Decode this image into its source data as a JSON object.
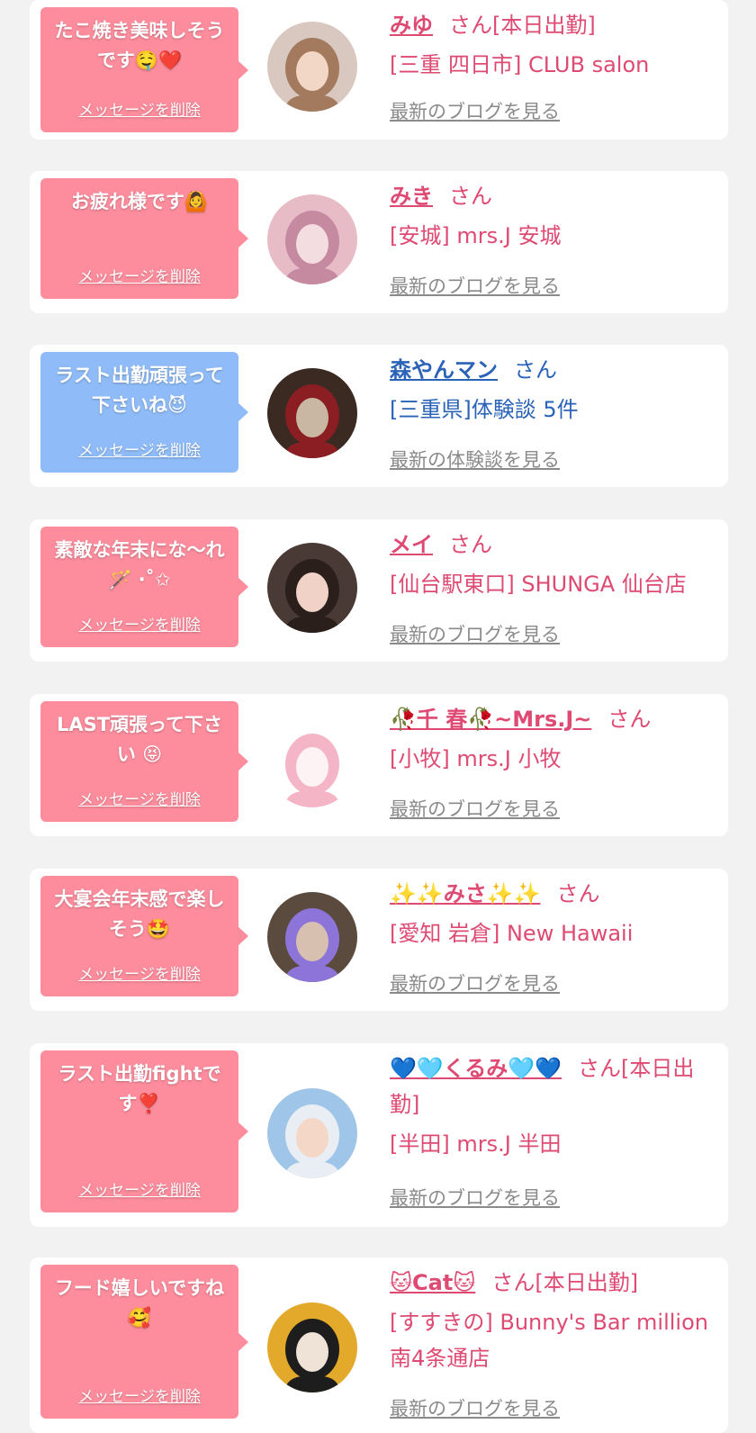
{
  "items": [
    {
      "message": "たこ焼き美味しそうです🤤❤️",
      "delete_label": "メッセージを削除",
      "name": "みゆ",
      "suffix": "さん[本日出勤]",
      "shop": "[三重 四日市] CLUB salon",
      "more": "最新のブログを見る",
      "theme": "pink",
      "avatar": {
        "bg": "#d9c8c0",
        "fg": "#a37a5e",
        "skin": "#f2d6c6"
      }
    },
    {
      "message": "お疲れ様です🙆",
      "delete_label": "メッセージを削除",
      "name": "みき",
      "suffix": "さん",
      "shop": "[安城] mrs.J 安城",
      "more": "最新のブログを見る",
      "theme": "pink",
      "avatar": {
        "bg": "#e8bcc6",
        "fg": "#c58aa0",
        "skin": "#f3dde0"
      }
    },
    {
      "message": "ラスト出勤頑張って下さいね😈",
      "delete_label": "メッセージを削除",
      "name": "森やんマン",
      "suffix": "さん",
      "shop": "[三重県]体験談 5件",
      "more": "最新の体験談を見る",
      "theme": "blue",
      "avatar": {
        "bg": "#3a2a22",
        "fg": "#8a1e22",
        "skin": "#c9b7a3"
      }
    },
    {
      "message": "素敵な年末にな〜れ🪄 ‧˚✩",
      "delete_label": "メッセージを削除",
      "name": "メイ",
      "suffix": "さん",
      "shop": "[仙台駅東口] SHUNGA 仙台店",
      "more": "最新のブログを見る",
      "theme": "pink",
      "avatar": {
        "bg": "#4a3a35",
        "fg": "#2b1f1b",
        "skin": "#f0d2c7"
      }
    },
    {
      "message": "LAST頑張って下さい 😝",
      "delete_label": "メッセージを削除",
      "name": "🥀千 春🥀~Mrs.J~",
      "suffix": "さん",
      "shop": "[小牧] mrs.J 小牧",
      "more": "最新のブログを見る",
      "theme": "pink",
      "avatar": {
        "bg": "#ffffff",
        "fg": "#f4b6c6",
        "skin": "#fdf3f5"
      }
    },
    {
      "message": "大宴会年末感で楽しそう🤩",
      "delete_label": "メッセージを削除",
      "name": "✨✨みさ✨✨",
      "suffix": "さん",
      "shop": "[愛知 岩倉] New Hawaii",
      "more": "最新のブログを見る",
      "theme": "pink",
      "avatar": {
        "bg": "#5b4b3f",
        "fg": "#8d74d8",
        "skin": "#d8c0b0"
      }
    },
    {
      "message": "ラスト出勤fightです❣️",
      "delete_label": "メッセージを削除",
      "name": "💙🩵くるみ🩵💙",
      "suffix": "さん[本日出勤]",
      "shop": "[半田] mrs.J 半田",
      "more": "最新のブログを見る",
      "theme": "pink",
      "avatar": {
        "bg": "#9fc6e8",
        "fg": "#e9eef5",
        "skin": "#f4d7c6"
      }
    },
    {
      "message": "フード嬉しいですね🥰",
      "delete_label": "メッセージを削除",
      "name": "🐱Cat🐱",
      "suffix": "さん[本日出勤]",
      "shop": "[すすきの] Bunny's Bar million 南4条通店",
      "more": "最新のブログを見る",
      "theme": "pink",
      "avatar": {
        "bg": "#e3a92a",
        "fg": "#1d1d1d",
        "skin": "#efe3d8"
      }
    }
  ]
}
